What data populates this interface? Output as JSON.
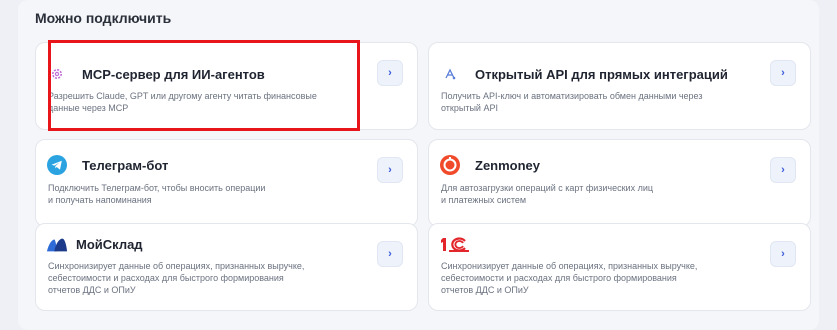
{
  "section": {
    "title": "Можно подключить"
  },
  "cards": [
    {
      "title": "MCP-сервер для ИИ-агентов",
      "desc_line1": "Разрешить Claude, GPT или другому агенту читать финансовые",
      "desc_line2": "данные через MCP",
      "icon": "gear-icon",
      "arrow": "›"
    },
    {
      "title": "Открытый API для прямых интеграций",
      "desc_line1": "Получить API-ключ и автоматизировать обмен данными через",
      "desc_line2": "открытый API",
      "icon": "api-icon",
      "arrow": "›"
    },
    {
      "title": "Телеграм-бот",
      "desc_line1": "Подключить Телеграм-бот, чтобы вносить операции",
      "desc_line2": "и получать напоминания",
      "icon": "telegram-icon",
      "arrow": "›"
    },
    {
      "title": "Zenmoney",
      "desc_line1": "Для автозагрузки операций с карт физических лиц",
      "desc_line2": "и платежных систем",
      "icon": "zenmoney-icon",
      "arrow": "›"
    },
    {
      "title": "МойСклад",
      "desc_line1": "Синхронизирует данные об операциях, признанных выручке,",
      "desc_line2": "себестоимости и расходах для быстрого формирования",
      "desc_line3": "отчетов ДДС и ОПиУ",
      "icon": "moysklad-logo",
      "arrow": "›"
    },
    {
      "title": "1С",
      "desc_line1": "Синхронизирует данные об операциях, признанных выручке,",
      "desc_line2": "себестоимости и расходах для быстрого формирования",
      "desc_line3": "отчетов ДДС и ОПиУ",
      "icon": "1c-logo",
      "arrow": "›"
    }
  ],
  "colors": {
    "accent": "#3b5bdb",
    "highlight": "#e8161b",
    "telegram": "#2aa3e0",
    "zenmoney": "#f04a2a",
    "onec": "#e3262b",
    "moysklad": "#1b3a8a"
  }
}
